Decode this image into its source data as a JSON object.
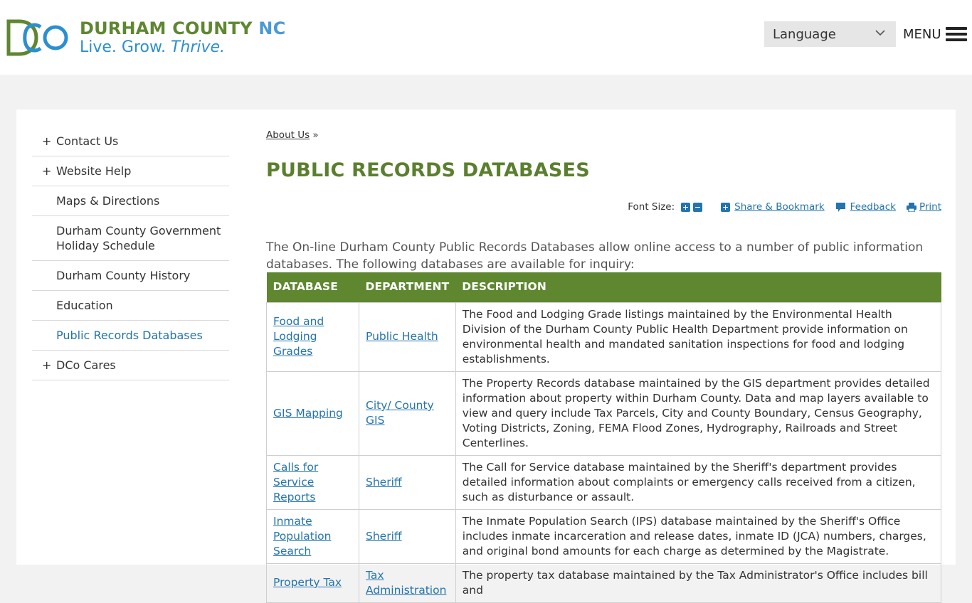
{
  "header": {
    "logo_name_part1": "DURHAM COUNTY",
    "logo_name_part2": "NC",
    "logo_tagline_part1": "Live. Grow.",
    "logo_tagline_part2": "Thrive.",
    "language_label": "Language",
    "menu_label": "MENU"
  },
  "sidebar": {
    "items": [
      {
        "label": "Contact Us"
      },
      {
        "label": "Website Help"
      },
      {
        "label": "Maps & Directions"
      },
      {
        "label": "Durham County Government Holiday Schedule"
      },
      {
        "label": "Durham County History"
      },
      {
        "label": "Education"
      },
      {
        "label": "Public Records Databases"
      },
      {
        "label": "DCo Cares"
      }
    ]
  },
  "breadcrumb": {
    "link": "About Us",
    "separator": "»"
  },
  "page_title": "PUBLIC RECORDS DATABASES",
  "tools": {
    "font_size_label": "Font Size:",
    "share_label": "Share & Bookmark",
    "feedback_label": "Feedback",
    "print_label": "Print"
  },
  "intro": "The On-line Durham County Public Records Databases allow online access to a number of public information databases. The following databases are available for inquiry:",
  "table": {
    "headers": [
      "DATABASE",
      "DEPARTMENT",
      "DESCRIPTION"
    ],
    "rows": [
      {
        "database": "Food and Lodging Grades",
        "department": "Public Health",
        "description": "The Food and Lodging Grade listings maintained by the Environmental Health Division of the Durham County Public Health Department provide information on environmental health and mandated sanitation inspections for food and lodging establishments."
      },
      {
        "database": "GIS Mapping",
        "department": "City/ County GIS",
        "description": "The Property Records database maintained by the GIS department provides detailed information about property within Durham County. Data and map layers available to view and query include Tax Parcels, City and County Boundary, Census Geography, Voting Districts, Zoning, FEMA Flood Zones, Hydrography, Railroads and Street Centerlines."
      },
      {
        "database": "Calls for Service Reports",
        "department": "Sheriff",
        "description": "The Call for Service database maintained by the Sheriff's department provides detailed information about complaints or emergency calls received from a citizen, such as disturbance or assault."
      },
      {
        "database": "Inmate Population Search",
        "department": "Sheriff",
        "description": "The Inmate Population Search (IPS) database maintained by the Sheriff's Office includes inmate incarceration and release dates, inmate ID (JCA) numbers, charges, and original bond amounts for each charge as determined by the Magistrate."
      },
      {
        "database": "Property Tax",
        "department": "Tax Administration",
        "description": "The property tax database maintained by the Tax Administrator's Office includes bill and"
      }
    ]
  },
  "colors": {
    "brand_green": "#5e8730",
    "brand_blue": "#2474ad",
    "logo_blue": "#4a9ad6"
  }
}
